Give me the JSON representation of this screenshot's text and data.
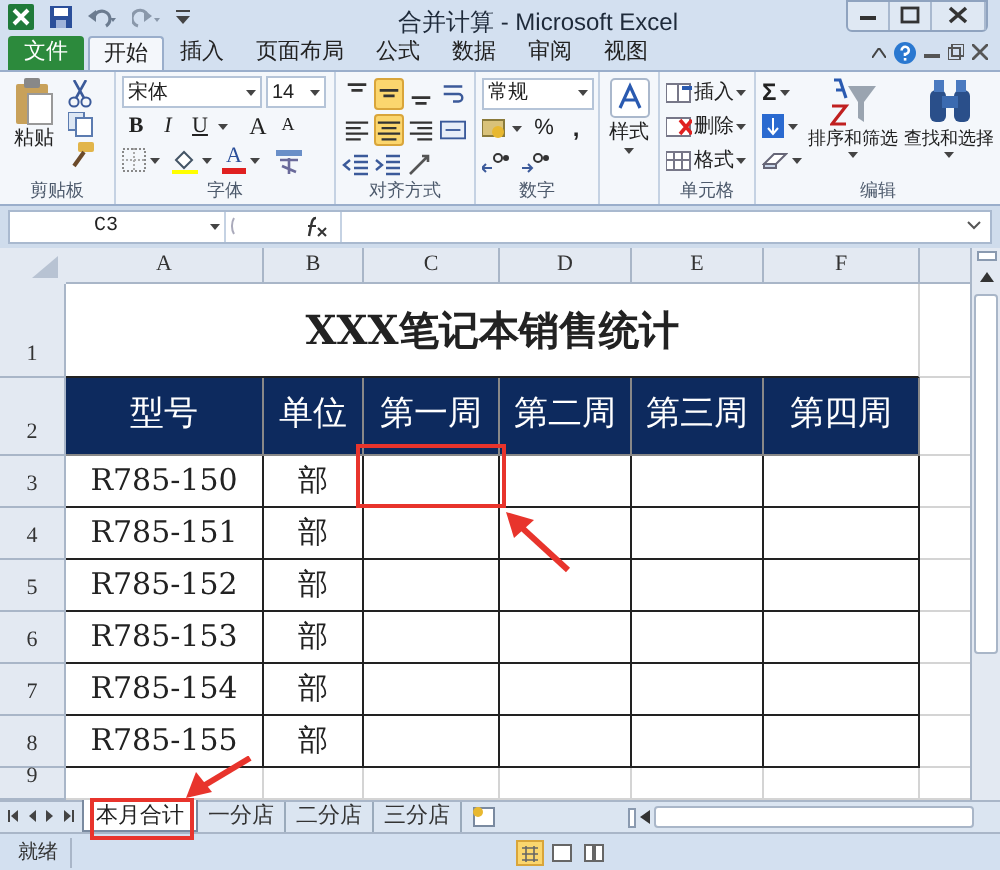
{
  "window": {
    "title": "合并计算 - Microsoft Excel"
  },
  "ribbon_tabs": [
    {
      "label": "文件",
      "kind": "file",
      "selected": false
    },
    {
      "label": "开始",
      "kind": "tab",
      "selected": true
    },
    {
      "label": "插入",
      "kind": "tab",
      "selected": false
    },
    {
      "label": "页面布局",
      "kind": "tab",
      "selected": false
    },
    {
      "label": "公式",
      "kind": "tab",
      "selected": false
    },
    {
      "label": "数据",
      "kind": "tab",
      "selected": false
    },
    {
      "label": "审阅",
      "kind": "tab",
      "selected": false
    },
    {
      "label": "视图",
      "kind": "tab",
      "selected": false
    }
  ],
  "clipboard": {
    "paste": "粘贴",
    "label": "剪贴板"
  },
  "font": {
    "name": "宋体",
    "size": "14",
    "bold": "B",
    "italic": "I",
    "underline": "U",
    "grow": "A",
    "shrink": "A",
    "font_color_button": "A",
    "label": "字体"
  },
  "alignment": {
    "label": "对齐方式",
    "buttons": [
      {
        "kind": "top",
        "selected": false
      },
      {
        "kind": "middle",
        "selected": true
      },
      {
        "kind": "bottom",
        "selected": false
      },
      {
        "kind": "wrap",
        "selected": false
      },
      {
        "kind": "left",
        "selected": false
      },
      {
        "kind": "center",
        "selected": true
      },
      {
        "kind": "right",
        "selected": false
      },
      {
        "kind": "merge",
        "selected": false
      }
    ]
  },
  "number": {
    "format": "常规",
    "percent": "%",
    "comma": ",",
    "label": "数字"
  },
  "styles": {
    "button": "样式"
  },
  "cells": {
    "items": [
      "插入",
      "删除",
      "格式"
    ],
    "label": "单元格"
  },
  "editing": {
    "sum": "Σ",
    "sort": "排序和筛选",
    "find": "查找和选择",
    "label": "编辑"
  },
  "formula_bar": {
    "name_box": "C3"
  },
  "sheet": {
    "columns": [
      "A",
      "B",
      "C",
      "D",
      "E",
      "F"
    ],
    "rows": [
      {
        "header": "1",
        "kind": "title",
        "cells": [
          "XXX笔记本销售统计"
        ]
      },
      {
        "header": "2",
        "kind": "heading",
        "cells": [
          "型号",
          "单位",
          "第一周",
          "第二周",
          "第三周",
          "第四周"
        ]
      },
      {
        "header": "3",
        "kind": "data",
        "cells": [
          "R785-150",
          "部"
        ]
      },
      {
        "header": "4",
        "kind": "data",
        "cells": [
          "R785-151",
          "部"
        ]
      },
      {
        "header": "5",
        "kind": "data",
        "cells": [
          "R785-152",
          "部"
        ]
      },
      {
        "header": "6",
        "kind": "data",
        "cells": [
          "R785-153",
          "部"
        ]
      },
      {
        "header": "7",
        "kind": "data",
        "cells": [
          "R785-154",
          "部"
        ]
      },
      {
        "header": "8",
        "kind": "data",
        "cells": [
          "R785-155",
          "部"
        ]
      },
      {
        "header": "9",
        "kind": "empty"
      }
    ]
  },
  "sheet_tabs": [
    {
      "label": "本月合计",
      "selected": true
    },
    {
      "label": "一分店",
      "selected": false
    },
    {
      "label": "二分店",
      "selected": false
    },
    {
      "label": "三分店",
      "selected": false
    }
  ],
  "status_bar": {
    "text": "就绪"
  }
}
